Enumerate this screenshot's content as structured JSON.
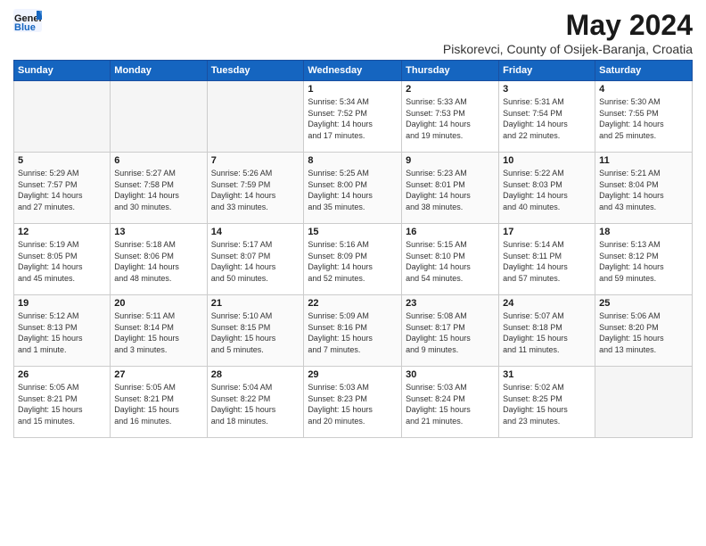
{
  "logo": {
    "general": "General",
    "blue": "Blue"
  },
  "title": "May 2024",
  "location": "Piskorevci, County of Osijek-Baranja, Croatia",
  "weekdays": [
    "Sunday",
    "Monday",
    "Tuesday",
    "Wednesday",
    "Thursday",
    "Friday",
    "Saturday"
  ],
  "weeks": [
    [
      {
        "day": "",
        "info": ""
      },
      {
        "day": "",
        "info": ""
      },
      {
        "day": "",
        "info": ""
      },
      {
        "day": "1",
        "info": "Sunrise: 5:34 AM\nSunset: 7:52 PM\nDaylight: 14 hours\nand 17 minutes."
      },
      {
        "day": "2",
        "info": "Sunrise: 5:33 AM\nSunset: 7:53 PM\nDaylight: 14 hours\nand 19 minutes."
      },
      {
        "day": "3",
        "info": "Sunrise: 5:31 AM\nSunset: 7:54 PM\nDaylight: 14 hours\nand 22 minutes."
      },
      {
        "day": "4",
        "info": "Sunrise: 5:30 AM\nSunset: 7:55 PM\nDaylight: 14 hours\nand 25 minutes."
      }
    ],
    [
      {
        "day": "5",
        "info": "Sunrise: 5:29 AM\nSunset: 7:57 PM\nDaylight: 14 hours\nand 27 minutes."
      },
      {
        "day": "6",
        "info": "Sunrise: 5:27 AM\nSunset: 7:58 PM\nDaylight: 14 hours\nand 30 minutes."
      },
      {
        "day": "7",
        "info": "Sunrise: 5:26 AM\nSunset: 7:59 PM\nDaylight: 14 hours\nand 33 minutes."
      },
      {
        "day": "8",
        "info": "Sunrise: 5:25 AM\nSunset: 8:00 PM\nDaylight: 14 hours\nand 35 minutes."
      },
      {
        "day": "9",
        "info": "Sunrise: 5:23 AM\nSunset: 8:01 PM\nDaylight: 14 hours\nand 38 minutes."
      },
      {
        "day": "10",
        "info": "Sunrise: 5:22 AM\nSunset: 8:03 PM\nDaylight: 14 hours\nand 40 minutes."
      },
      {
        "day": "11",
        "info": "Sunrise: 5:21 AM\nSunset: 8:04 PM\nDaylight: 14 hours\nand 43 minutes."
      }
    ],
    [
      {
        "day": "12",
        "info": "Sunrise: 5:19 AM\nSunset: 8:05 PM\nDaylight: 14 hours\nand 45 minutes."
      },
      {
        "day": "13",
        "info": "Sunrise: 5:18 AM\nSunset: 8:06 PM\nDaylight: 14 hours\nand 48 minutes."
      },
      {
        "day": "14",
        "info": "Sunrise: 5:17 AM\nSunset: 8:07 PM\nDaylight: 14 hours\nand 50 minutes."
      },
      {
        "day": "15",
        "info": "Sunrise: 5:16 AM\nSunset: 8:09 PM\nDaylight: 14 hours\nand 52 minutes."
      },
      {
        "day": "16",
        "info": "Sunrise: 5:15 AM\nSunset: 8:10 PM\nDaylight: 14 hours\nand 54 minutes."
      },
      {
        "day": "17",
        "info": "Sunrise: 5:14 AM\nSunset: 8:11 PM\nDaylight: 14 hours\nand 57 minutes."
      },
      {
        "day": "18",
        "info": "Sunrise: 5:13 AM\nSunset: 8:12 PM\nDaylight: 14 hours\nand 59 minutes."
      }
    ],
    [
      {
        "day": "19",
        "info": "Sunrise: 5:12 AM\nSunset: 8:13 PM\nDaylight: 15 hours\nand 1 minute."
      },
      {
        "day": "20",
        "info": "Sunrise: 5:11 AM\nSunset: 8:14 PM\nDaylight: 15 hours\nand 3 minutes."
      },
      {
        "day": "21",
        "info": "Sunrise: 5:10 AM\nSunset: 8:15 PM\nDaylight: 15 hours\nand 5 minutes."
      },
      {
        "day": "22",
        "info": "Sunrise: 5:09 AM\nSunset: 8:16 PM\nDaylight: 15 hours\nand 7 minutes."
      },
      {
        "day": "23",
        "info": "Sunrise: 5:08 AM\nSunset: 8:17 PM\nDaylight: 15 hours\nand 9 minutes."
      },
      {
        "day": "24",
        "info": "Sunrise: 5:07 AM\nSunset: 8:18 PM\nDaylight: 15 hours\nand 11 minutes."
      },
      {
        "day": "25",
        "info": "Sunrise: 5:06 AM\nSunset: 8:20 PM\nDaylight: 15 hours\nand 13 minutes."
      }
    ],
    [
      {
        "day": "26",
        "info": "Sunrise: 5:05 AM\nSunset: 8:21 PM\nDaylight: 15 hours\nand 15 minutes."
      },
      {
        "day": "27",
        "info": "Sunrise: 5:05 AM\nSunset: 8:21 PM\nDaylight: 15 hours\nand 16 minutes."
      },
      {
        "day": "28",
        "info": "Sunrise: 5:04 AM\nSunset: 8:22 PM\nDaylight: 15 hours\nand 18 minutes."
      },
      {
        "day": "29",
        "info": "Sunrise: 5:03 AM\nSunset: 8:23 PM\nDaylight: 15 hours\nand 20 minutes."
      },
      {
        "day": "30",
        "info": "Sunrise: 5:03 AM\nSunset: 8:24 PM\nDaylight: 15 hours\nand 21 minutes."
      },
      {
        "day": "31",
        "info": "Sunrise: 5:02 AM\nSunset: 8:25 PM\nDaylight: 15 hours\nand 23 minutes."
      },
      {
        "day": "",
        "info": ""
      }
    ]
  ]
}
